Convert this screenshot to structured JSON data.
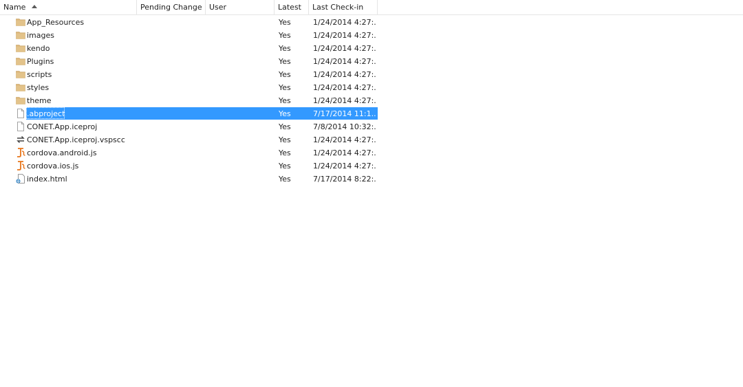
{
  "columns": {
    "name": "Name",
    "pending_change": "Pending Change",
    "user": "User",
    "latest": "Latest",
    "last_checkin": "Last Check-in"
  },
  "sort": {
    "column": "name",
    "direction": "ascending",
    "icon": "sort-ascending-icon"
  },
  "colors": {
    "selection": "#3399ff",
    "folder": "#dcb67a",
    "js_file": "#e8751a",
    "header_border": "#e5e5e5"
  },
  "rows": [
    {
      "name": "App_Resources",
      "type": "folder",
      "icon": "folder-icon",
      "latest": "Yes",
      "last_checkin": "1/24/2014 4:27:..."
    },
    {
      "name": "images",
      "type": "folder",
      "icon": "folder-icon",
      "latest": "Yes",
      "last_checkin": "1/24/2014 4:27:..."
    },
    {
      "name": "kendo",
      "type": "folder",
      "icon": "folder-icon",
      "latest": "Yes",
      "last_checkin": "1/24/2014 4:27:..."
    },
    {
      "name": "Plugins",
      "type": "folder",
      "icon": "folder-icon",
      "latest": "Yes",
      "last_checkin": "1/24/2014 4:27:..."
    },
    {
      "name": "scripts",
      "type": "folder",
      "icon": "folder-icon",
      "latest": "Yes",
      "last_checkin": "1/24/2014 4:27:..."
    },
    {
      "name": "styles",
      "type": "folder",
      "icon": "folder-icon",
      "latest": "Yes",
      "last_checkin": "1/24/2014 4:27:..."
    },
    {
      "name": "theme",
      "type": "folder",
      "icon": "folder-icon",
      "latest": "Yes",
      "last_checkin": "1/24/2014 4:27:..."
    },
    {
      "name": ".abproject",
      "type": "file",
      "icon": "file-icon",
      "latest": "Yes",
      "last_checkin": "7/17/2014 11:1...",
      "selected": true
    },
    {
      "name": "CONET.App.iceproj",
      "type": "file",
      "icon": "file-icon",
      "latest": "Yes",
      "last_checkin": "7/8/2014 10:32:..."
    },
    {
      "name": "CONET.App.iceproj.vspscc",
      "type": "sync",
      "icon": "source-control-icon",
      "latest": "Yes",
      "last_checkin": "1/24/2014 4:27:..."
    },
    {
      "name": "cordova.android.js",
      "type": "js",
      "icon": "javascript-file-icon",
      "latest": "Yes",
      "last_checkin": "1/24/2014 4:27:..."
    },
    {
      "name": "cordova.ios.js",
      "type": "js",
      "icon": "javascript-file-icon",
      "latest": "Yes",
      "last_checkin": "1/24/2014 4:27:..."
    },
    {
      "name": "index.html",
      "type": "html",
      "icon": "html-file-icon",
      "latest": "Yes",
      "last_checkin": "7/17/2014 8:22:..."
    }
  ]
}
